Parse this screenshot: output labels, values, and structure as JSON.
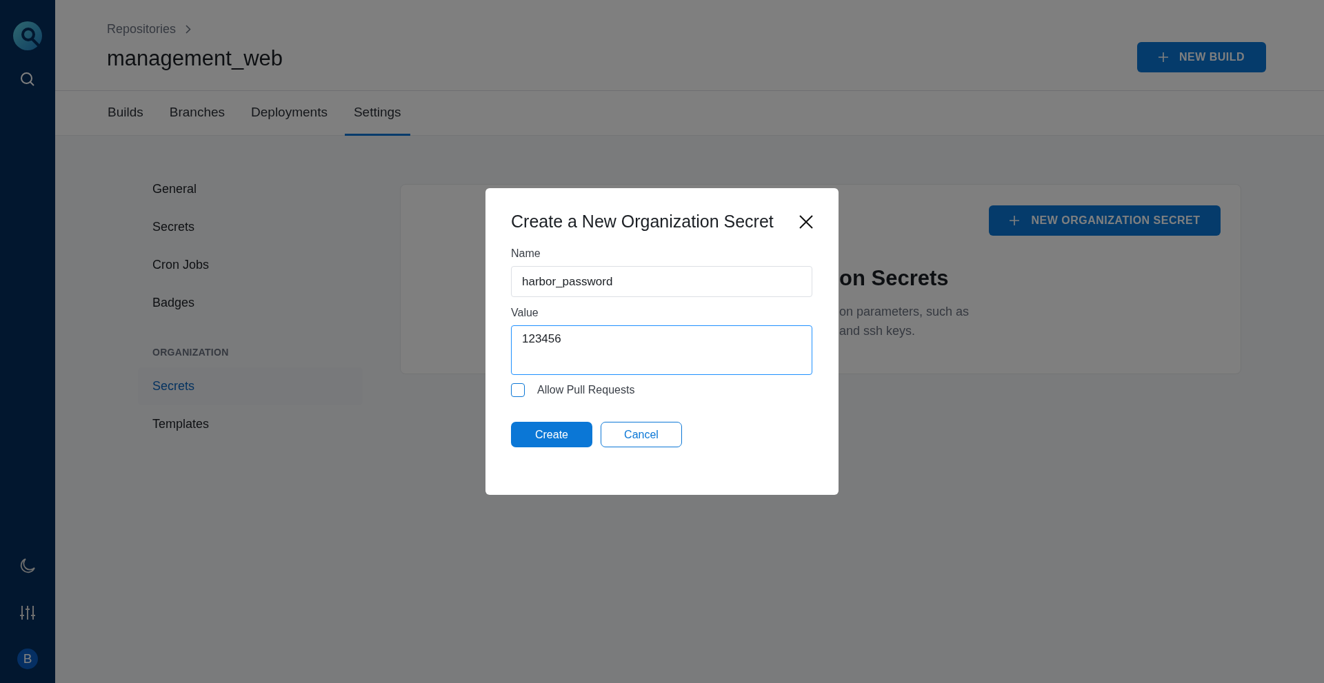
{
  "nav_rail": {
    "avatar": "B"
  },
  "breadcrumb": [
    "Repositories"
  ],
  "title": "management_web",
  "new_build_button": "NEW BUILD",
  "tabs": [
    {
      "label": "Builds",
      "selected": false
    },
    {
      "label": "Branches",
      "selected": false
    },
    {
      "label": "Deployments",
      "selected": false
    },
    {
      "label": "Settings",
      "selected": true
    }
  ],
  "settings_nav": {
    "items": [
      {
        "label": "General",
        "selected": false
      },
      {
        "label": "Secrets",
        "selected": false
      },
      {
        "label": "Cron Jobs",
        "selected": false
      },
      {
        "label": "Badges",
        "selected": false
      }
    ],
    "section": "ORGANIZATION",
    "org_items": [
      {
        "label": "Secrets",
        "selected": true
      },
      {
        "label": "Templates",
        "selected": false
      }
    ]
  },
  "card": {
    "button": "NEW ORGANIZATION SECRET",
    "heading": "on Secrets",
    "description_lines": [
      "on parameters, such as",
      "and ssh keys."
    ]
  },
  "dialog": {
    "title": "Create a New Organization Secret",
    "fields": [
      {
        "kind": "input",
        "label": "Name",
        "value": "harbor_password",
        "focused": false
      },
      {
        "kind": "textarea",
        "label": "Value",
        "value": "123456",
        "focused": true
      }
    ],
    "checkbox": {
      "label": "Allow Pull Requests",
      "checked": false
    },
    "buttons": [
      {
        "kind": "primary",
        "label": "Create"
      },
      {
        "kind": "secondary",
        "label": "Cancel"
      }
    ]
  }
}
